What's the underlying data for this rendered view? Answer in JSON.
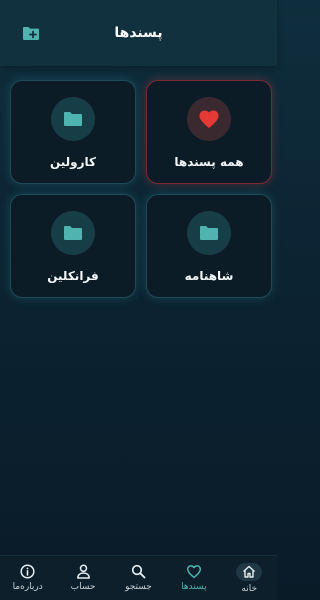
{
  "header": {
    "title": "پسندها"
  },
  "folders": [
    {
      "label": "همه پسندها",
      "icon": "heart-icon"
    },
    {
      "label": "کارولین",
      "icon": "folder-icon"
    },
    {
      "label": "شاهنامه",
      "icon": "folder-icon"
    },
    {
      "label": "فرانکلین",
      "icon": "folder-icon"
    }
  ],
  "bottom_nav": [
    {
      "label": "خانه",
      "icon": "home-icon"
    },
    {
      "label": "پسندها",
      "icon": "heart-outline-icon",
      "active": true
    },
    {
      "label": "جستجو",
      "icon": "search-icon"
    },
    {
      "label": "حساب",
      "icon": "person-icon"
    },
    {
      "label": "درباره‌ما",
      "icon": "info-icon"
    }
  ],
  "colors": {
    "accent": "#4fb3b0",
    "heart": "#e53935",
    "background": "#0c2433"
  }
}
